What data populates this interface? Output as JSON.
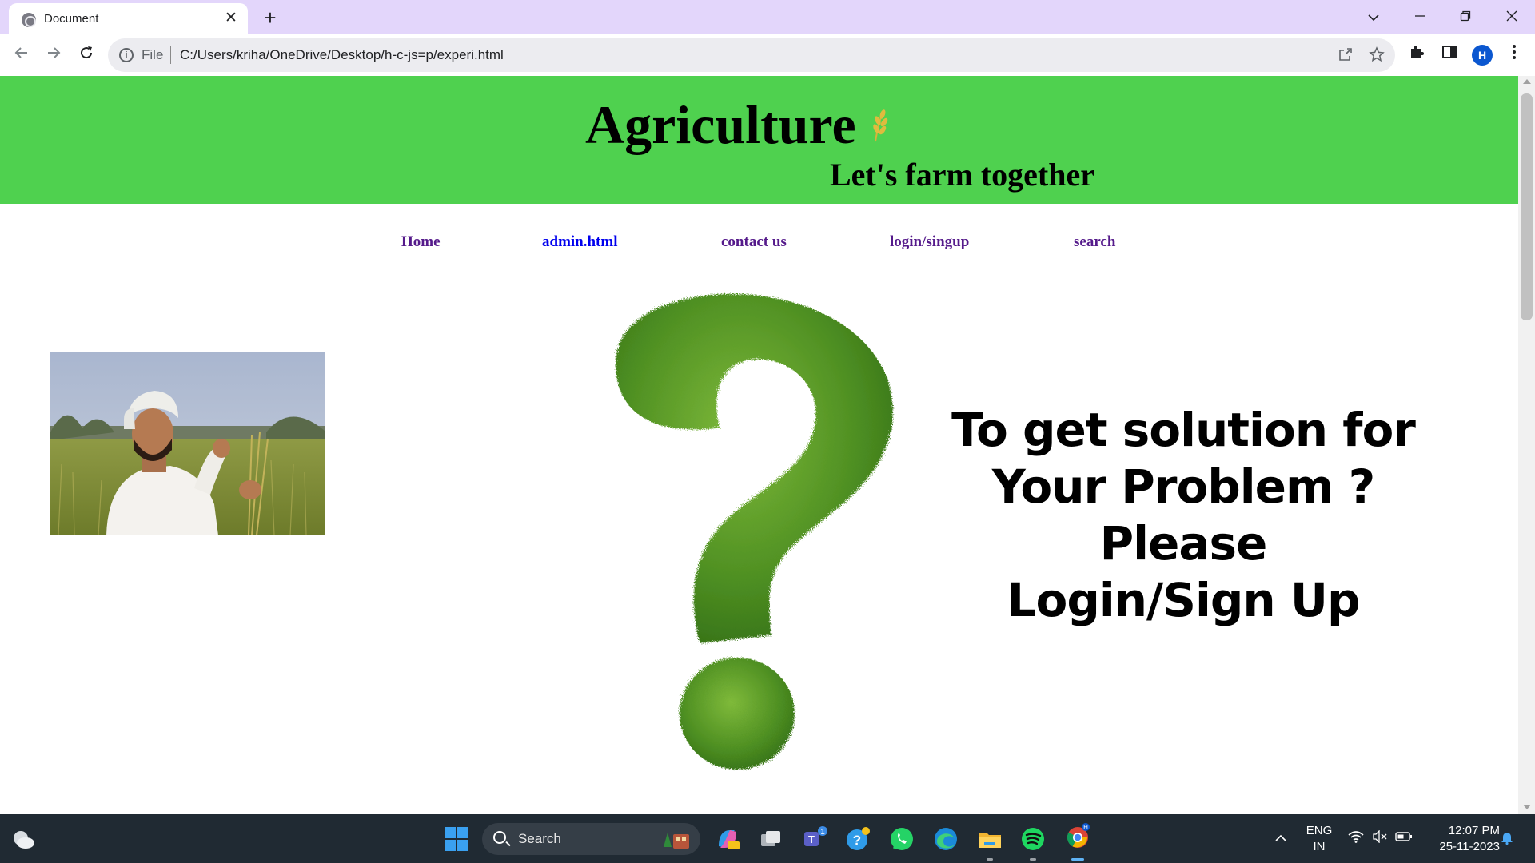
{
  "browser": {
    "tab_title": "Document",
    "tab_close": "✕",
    "new_tab": "+",
    "url_scheme_label": "File",
    "url": "C:/Users/kriha/OneDrive/Desktop/h-c-js=p/experi.html",
    "profile_initial": "H"
  },
  "site": {
    "title": "Agriculture",
    "tagline": "Let's farm together",
    "header_color": "#4fd14f"
  },
  "nav": {
    "items": [
      {
        "label": "Home",
        "state": "visited"
      },
      {
        "label": "admin.html",
        "state": "unvisited"
      },
      {
        "label": "contact us",
        "state": "visited"
      },
      {
        "label": "login/singup",
        "state": "visited"
      },
      {
        "label": "search",
        "state": "visited"
      }
    ]
  },
  "main": {
    "cta_lines": [
      "To get solution for",
      "Your Problem ?",
      "Please",
      "Login/Sign Up"
    ],
    "farmer_image": "farmer-photo",
    "question_image": "grass-question-mark"
  },
  "taskbar": {
    "search_label": "Search",
    "language_line1": "ENG",
    "language_line2": "IN",
    "time": "12:07 PM",
    "date": "25-11-2023",
    "teams_badge": "1"
  }
}
